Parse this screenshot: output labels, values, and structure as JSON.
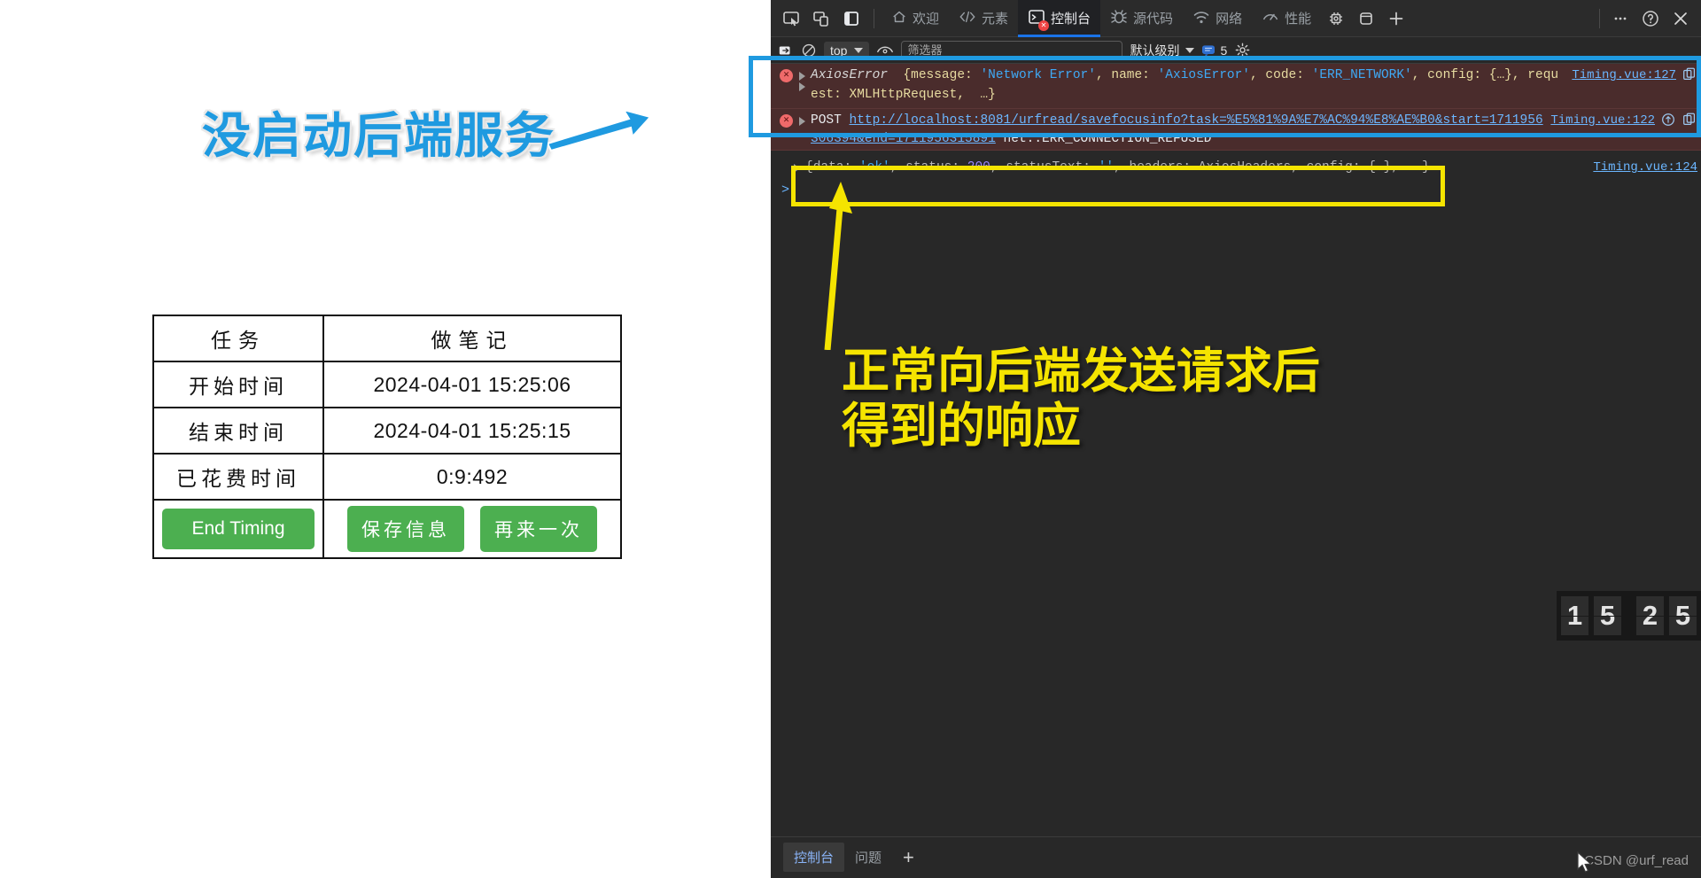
{
  "page": {
    "table": {
      "rows": [
        {
          "label": "任务",
          "value": "做笔记",
          "header": true
        },
        {
          "label": "开始时间",
          "value": "2024-04-01 15:25:06",
          "header": false
        },
        {
          "label": "结束时间",
          "value": "2024-04-01 15:25:15",
          "header": false
        },
        {
          "label": "已花费时间",
          "value": "0:9:492",
          "header": false
        }
      ],
      "buttons": {
        "end_timing": "End Timing",
        "save_info": "保存信息",
        "again": "再来一次"
      },
      "button_color": "#4caf50"
    }
  },
  "annotations": {
    "blue_title": "没启动后端服务",
    "blue_color": "#1f9ae0",
    "yellow_title": "正常向后端发送请求后\n得到的响应",
    "yellow_color": "#f5e400"
  },
  "devtools": {
    "toolbar": {
      "icons": [
        {
          "name": "inspect-element-icon",
          "glyph": "inspect"
        },
        {
          "name": "device-toolbar-icon",
          "glyph": "device"
        },
        {
          "name": "dock-side-icon",
          "glyph": "dock"
        }
      ],
      "tabs": [
        {
          "label": "欢迎",
          "icon": "home-icon",
          "active": false
        },
        {
          "label": "元素",
          "icon": "code-icon",
          "active": false
        },
        {
          "label": "控制台",
          "icon": "console-icon",
          "active": true
        },
        {
          "label": "源代码",
          "icon": "bug-icon",
          "active": false
        },
        {
          "label": "网络",
          "icon": "wifi-icon",
          "active": false
        },
        {
          "label": "性能",
          "icon": "gauge-icon",
          "active": false
        }
      ],
      "right_icons": [
        {
          "name": "memory-chip-icon"
        },
        {
          "name": "application-icon"
        },
        {
          "name": "add-panel-icon"
        },
        {
          "name": "more-options-icon"
        },
        {
          "name": "help-icon"
        },
        {
          "name": "close-icon"
        }
      ]
    },
    "console_bar": {
      "clear_icon": "clear-console-icon",
      "no_entry_icon": "no-entry-icon",
      "context": "top",
      "eye_icon": "live-expression-icon",
      "filter_placeholder": "筛选器",
      "filter_value": "",
      "level": "默认级别",
      "message_count": "5",
      "settings_icon": "console-settings-icon"
    },
    "logs": [
      {
        "type": "error",
        "segments": [
          {
            "t": "AxiosError  ",
            "c": "tok-key"
          },
          {
            "t": "{message: ",
            "c": "tok-yellow"
          },
          {
            "t": "'Network Error'",
            "c": "tok-str"
          },
          {
            "t": ", name: ",
            "c": "tok-yellow"
          },
          {
            "t": "'AxiosError'",
            "c": "tok-str"
          },
          {
            "t": ", code: ",
            "c": "tok-yellow"
          },
          {
            "t": "'ERR_NETWORK'",
            "c": "tok-str"
          },
          {
            "t": ", config: {…}, request: XMLHttpRequest,  …}",
            "c": "tok-yellow"
          }
        ],
        "source": "Timing.vue:127",
        "copy_icon": true
      },
      {
        "type": "error",
        "segments": [
          {
            "t": "POST ",
            "c": "tok-white"
          },
          {
            "t": "http://localhost:8081/urfread/savefocusinfo?task=%E5%81%9A%E7%AC%94%E8%AE%B0&start=1711956306394&end=1711956315891",
            "c": "tok-url"
          },
          {
            "t": " net::ERR_CONNECTION_REFUSED",
            "c": "tok-white"
          }
        ],
        "source": "Timing.vue:122",
        "copy_icon": true,
        "issue_icon": true
      },
      {
        "type": "log",
        "segments": [
          {
            "t": "{data: ",
            "c": "tok-dim"
          },
          {
            "t": "'ok'",
            "c": "tok-str"
          },
          {
            "t": ", status: ",
            "c": "tok-dim"
          },
          {
            "t": "200",
            "c": "tok-num"
          },
          {
            "t": ", statusText: ",
            "c": "tok-dim"
          },
          {
            "t": "''",
            "c": "tok-str"
          },
          {
            "t": ", headers: AxiosHeaders, config: {…},  …}",
            "c": "tok-dim"
          }
        ],
        "source": "Timing.vue:124"
      }
    ],
    "prompt": ">",
    "bottom": {
      "tabs": [
        {
          "label": "控制台",
          "active": true
        },
        {
          "label": "问题",
          "active": false
        }
      ],
      "add_label": "+"
    },
    "watermark": "CSDN @urf_read"
  },
  "flip_clock": {
    "digits": [
      "1",
      "5",
      "2",
      "5"
    ]
  }
}
